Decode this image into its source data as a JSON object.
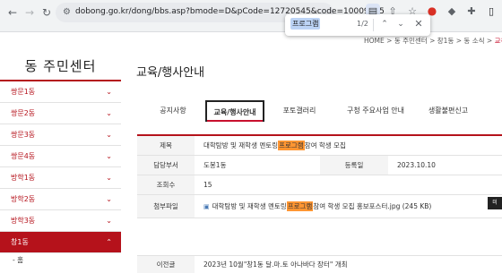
{
  "browser": {
    "url": "dobong.go.kr/dong/bbs.asp?bmode=D&pCode=12720545&code=10009725",
    "find": {
      "query": "프로그램",
      "count": "1/2"
    }
  },
  "breadcrumb": [
    "HOME",
    "동 주민센터",
    "창1동",
    "동 소식",
    "교육"
  ],
  "sidebar": {
    "title": "동 주민센터",
    "items": [
      {
        "label": "쌍문1동"
      },
      {
        "label": "쌍문2동"
      },
      {
        "label": "쌍문3동"
      },
      {
        "label": "쌍문4동"
      },
      {
        "label": "방학1동"
      },
      {
        "label": "방학2동"
      },
      {
        "label": "방학3동"
      },
      {
        "label": "창1동"
      }
    ],
    "sub_items": [
      "홈"
    ]
  },
  "main": {
    "title": "교육/행사안내",
    "tabs": [
      {
        "label": "공지사항"
      },
      {
        "label": "교육/행사안내"
      },
      {
        "label": "포토갤러리"
      },
      {
        "label": "구청 주요사업 안내"
      },
      {
        "label": "생활불편신고"
      }
    ],
    "post": {
      "subject_label": "제목",
      "subject_before": "대학탐방 및 재학생 멘토링 ",
      "subject_highlight": "프로그램",
      "subject_after": " 참여 학생 모집",
      "dept_label": "담당부서",
      "dept_value": "도봉1동",
      "date_label": "등록일",
      "date_value": "2023.10.10",
      "views_label": "조회수",
      "views_value": "15",
      "file_label": "첨부파일",
      "file_before": "대학탐방 및 재학생 멘토링 ",
      "file_highlight": "프로그램",
      "file_after": " 참여 학생 모집 홍보포스터.jpg (245 KB)",
      "view_button": "미"
    },
    "prev": {
      "label": "이전글",
      "value": "2023년 10월\"창1동 달.마.토 아나바다 장터\" 개최"
    }
  },
  "colors": {
    "accent": "#b5121b",
    "highlight": "#ff9632"
  }
}
